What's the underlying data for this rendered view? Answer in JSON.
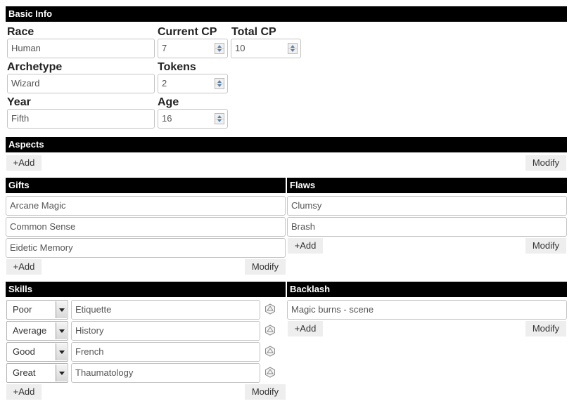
{
  "basic_info": {
    "header": "Basic Info",
    "race": {
      "label": "Race",
      "value": "Human"
    },
    "current_cp": {
      "label": "Current CP",
      "value": "7"
    },
    "total_cp": {
      "label": "Total CP",
      "value": "10"
    },
    "archetype": {
      "label": "Archetype",
      "value": "Wizard"
    },
    "tokens": {
      "label": "Tokens",
      "value": "2"
    },
    "year": {
      "label": "Year",
      "value": "Fifth"
    },
    "age": {
      "label": "Age",
      "value": "16"
    }
  },
  "aspects": {
    "header": "Aspects",
    "add_label": "+Add",
    "modify_label": "Modify"
  },
  "gifts": {
    "header": "Gifts",
    "items": [
      "Arcane Magic",
      "Common Sense",
      "Eidetic Memory"
    ],
    "add_label": "+Add",
    "modify_label": "Modify"
  },
  "flaws": {
    "header": "Flaws",
    "items": [
      "Clumsy",
      "Brash"
    ],
    "add_label": "+Add",
    "modify_label": "Modify"
  },
  "skills": {
    "header": "Skills",
    "rows": [
      {
        "level": "Poor",
        "name": "Etiquette"
      },
      {
        "level": "Average",
        "name": "History"
      },
      {
        "level": "Good",
        "name": "French"
      },
      {
        "level": "Great",
        "name": "Thaumatology"
      }
    ],
    "roll_icon": "dice-icon",
    "add_label": "+Add",
    "modify_label": "Modify"
  },
  "backlash": {
    "header": "Backlash",
    "items": [
      "Magic burns - scene"
    ],
    "add_label": "+Add",
    "modify_label": "Modify"
  }
}
